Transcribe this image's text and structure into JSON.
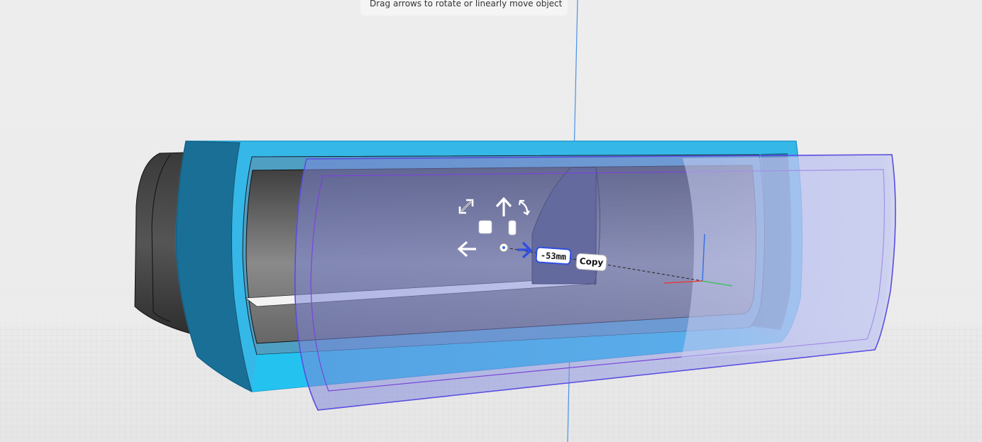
{
  "hint": {
    "text": "Drag arrows to rotate or linearly move object"
  },
  "move_tool": {
    "distance_value": "-53mm",
    "copy_label": "Copy"
  },
  "icons": {
    "scale_diag": "resize-diagonal-icon",
    "move_up": "arrow-up-icon",
    "rotate": "rotate-icon",
    "move_left": "arrow-left-icon",
    "move_right": "arrow-right-icon",
    "center": "center-point-icon",
    "face_select": "face-select-icon",
    "edge_select": "edge-select-icon",
    "axes": "axis-triad-icon"
  },
  "colors": {
    "background": "#ececec",
    "grid_line": "#dadada",
    "object_cyan": "#35b8e8",
    "object_dark": "#1a6f96",
    "selection_purple": "#5a4de0",
    "ghost_fill": "#9aa5ee",
    "guide_blue": "#4a90e8",
    "axis_red": "#e04040",
    "axis_green": "#40c060",
    "axis_blue": "#2f6fe0"
  }
}
